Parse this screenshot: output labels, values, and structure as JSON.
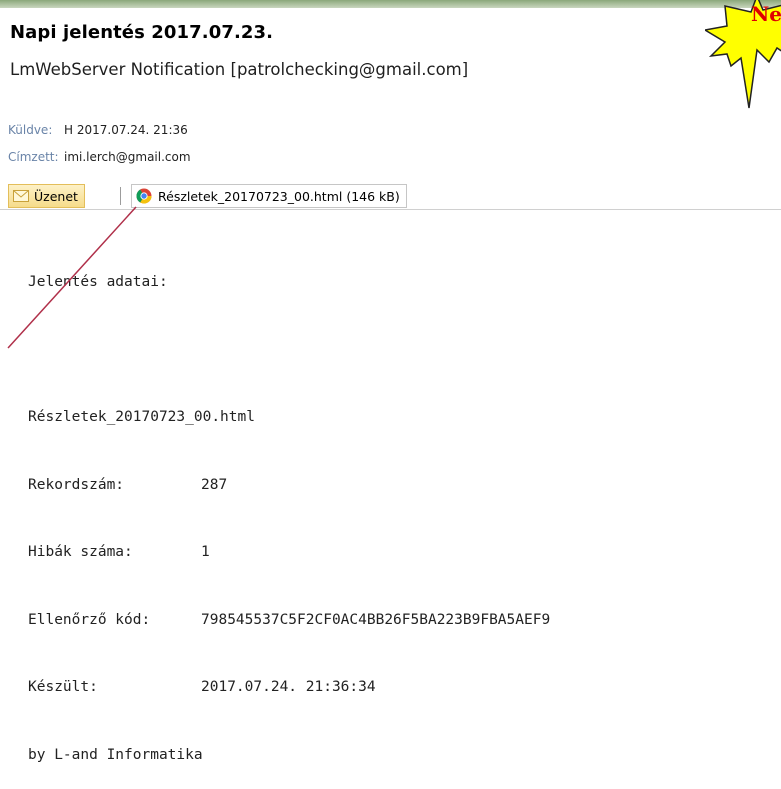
{
  "email": {
    "subject": "Napi jelentés 2017.07.23.",
    "sender": "LmWebServer Notification [patrolchecking@gmail.com]",
    "sent_label": "Küldve:",
    "sent_value": "H 2017.07.24. 21:36",
    "to_label": "Címzett:",
    "to_value": "imi.lerch@gmail.com"
  },
  "attachments": {
    "message_tab": "Üzenet",
    "file_label": "Részletek_20170723_00.html (146 kB)"
  },
  "body": {
    "heading": "Jelentés adatai:",
    "filename": "Részletek_20170723_00.html",
    "rows": [
      {
        "key": "Rekordszám:",
        "value": "287"
      },
      {
        "key": "Hibák száma:",
        "value": "1"
      },
      {
        "key": "Ellenőrző kód:",
        "value": "798545537C5F2CF0AC4BB26F5BA223B9FBA5AEF9"
      },
      {
        "key": "Készült:",
        "value": "2017.07.24. 21:36:34"
      }
    ],
    "footer": "by L-and Informatika"
  },
  "callout": {
    "text": "Ne",
    "color": "#e00000",
    "fill": "#ffff00"
  },
  "icons": {
    "message": "envelope-icon",
    "file": "chrome-icon"
  }
}
